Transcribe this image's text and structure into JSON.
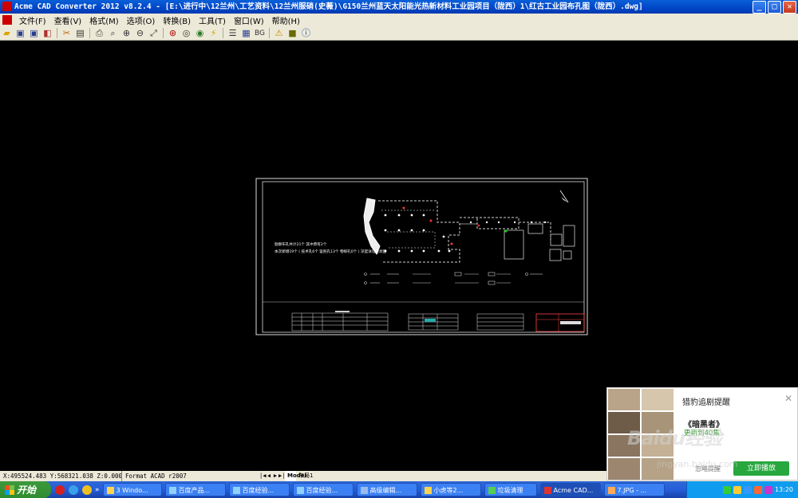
{
  "window": {
    "title": "Acme CAD Converter 2012 v8.2.4 - [E:\\进行中\\12兰州\\工艺资料\\12兰州服硝(史薇)\\G150兰州蓝天太阳能光热新材料工业园项目（陇西）1\\红古工业园布孔图（陇西）.dwg]",
    "buttons": {
      "minimize": "_",
      "maximize": "□",
      "close": "✕"
    }
  },
  "menu": {
    "items": [
      "文件(F)",
      "查看(V)",
      "格式(M)",
      "选项(O)",
      "转换(B)",
      "工具(T)",
      "窗口(W)",
      "帮助(H)"
    ]
  },
  "toolbar": {
    "icons": [
      "open-icon",
      "save-icon",
      "save-as-icon",
      "batch-convert-icon",
      "export-icon",
      "print-icon",
      "zoom-icon",
      "zoom-in-icon",
      "zoom-out-icon",
      "zoom-window-icon",
      "zoom-extents-icon",
      "pan-icon",
      "hide-icon",
      "layers-icon",
      "bg-icon",
      "warning-icon",
      "bookmark-icon",
      "info-icon"
    ],
    "bg_label": "BG"
  },
  "drawing": {
    "note_line1": "勘察布孔共计21个  其中原有2个",
    "note_line2": "本次新增19个 ( 技术孔6个 鉴别孔13个 物探孔0个 ) 深度详见柱状图"
  },
  "status": {
    "coordinates": "X:495524.483 Y:568321.038 Z:0.000",
    "format": "Format ACAD r2007",
    "layout_tabs": [
      "Model",
      "布局1"
    ],
    "active_tab": "Model"
  },
  "taskbar": {
    "start_label": "开始",
    "tasks": [
      "3 Windo...",
      "百度产品...",
      "百度经验...",
      "百度经验...",
      "高级编辑...",
      "小虎等2...",
      "垃圾清理",
      "Acme CAD...",
      "7.JPG - ..."
    ],
    "active_task": 7,
    "clock": "13:20"
  },
  "popup": {
    "title": "猎豹追剧提醒",
    "close_label": "✕",
    "show_title": "《暗黑者》",
    "update_text": "更新到40集",
    "ignore_label": "忽略提醒",
    "play_button": "立即播放"
  },
  "watermark": {
    "logo_text": "Baidu经验",
    "url": "jingyan.baidu.com"
  },
  "colors": {
    "titlebar": "#0046c8",
    "canvas": "#000000",
    "chrome": "#ece9d8",
    "taskbar": "#245edb",
    "start": "#2f8c2f",
    "popup_button": "#27a83f"
  }
}
